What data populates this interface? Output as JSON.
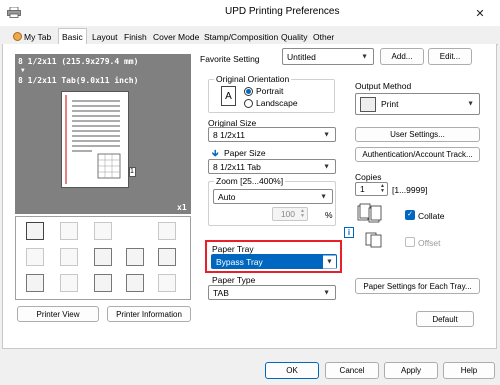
{
  "window": {
    "title": "UPD Printing Preferences"
  },
  "titlebar": {
    "close_label": "✕"
  },
  "tabs": [
    "My Tab",
    "Basic",
    "Layout",
    "Finish",
    "Cover Mode",
    "Stamp/Composition",
    "Quality",
    "Other"
  ],
  "preview": {
    "size_line1": "8 1/2x11 (215.9x279.4 mm)",
    "arrow": "▼",
    "size_line2": "8 1/2x11 Tab(9.0x11 inch)",
    "copies": "x1",
    "tab_number": "1"
  },
  "left_buttons": {
    "printer_view": "Printer View",
    "printer_information": "Printer Information"
  },
  "favorite": {
    "label": "Favorite Setting",
    "value": "Untitled",
    "add": "Add...",
    "edit": "Edit..."
  },
  "orientation": {
    "legend": "Original Orientation",
    "portrait": "Portrait",
    "landscape": "Landscape",
    "icon": "A"
  },
  "original_size": {
    "label": "Original Size",
    "value": "8 1/2x11"
  },
  "paper_size": {
    "label": "Paper Size",
    "value": "8 1/2x11 Tab"
  },
  "zoom": {
    "label": "Zoom [25...400%]",
    "value": "Auto",
    "number": "100",
    "unit": "%"
  },
  "paper_tray": {
    "label": "Paper Tray",
    "value": "Bypass Tray"
  },
  "paper_type": {
    "label": "Paper Type",
    "value": "TAB"
  },
  "output_method": {
    "label": "Output Method",
    "value": "Print"
  },
  "user_settings": "User Settings...",
  "authentication": "Authentication/Account Track...",
  "copies": {
    "label": "Copies",
    "value": "1",
    "range": "[1...9999]"
  },
  "collate": {
    "label": "Collate",
    "checked": true
  },
  "offset": {
    "label": "Offset",
    "checked": false
  },
  "paper_settings_each_tray": "Paper Settings for Each Tray...",
  "default_btn": "Default",
  "dialog": {
    "ok": "OK",
    "cancel": "Cancel",
    "apply": "Apply",
    "help": "Help"
  },
  "colors": {
    "accent": "#0067c0",
    "highlight_border": "#e8202a",
    "preview_bg": "#808080"
  }
}
